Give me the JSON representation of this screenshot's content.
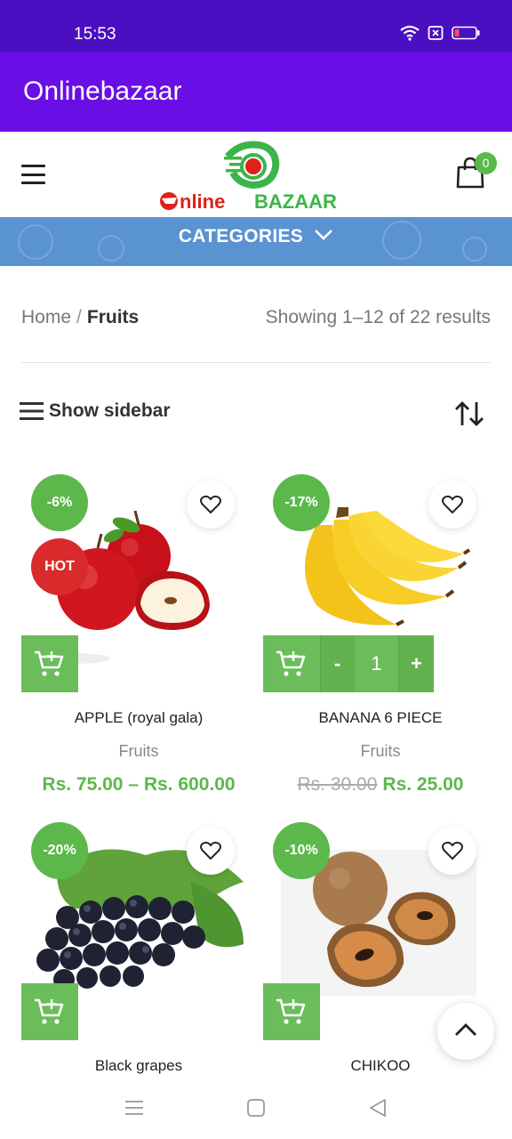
{
  "status_bar": {
    "time": "15:53",
    "icons": [
      "wifi-icon",
      "no-sim-icon",
      "battery-low-icon"
    ]
  },
  "app_bar": {
    "title": "Onlinebazaar"
  },
  "header": {
    "logo_text_prefix": "nline",
    "logo_text_suffix": "BAZAAR",
    "cart_count": "0"
  },
  "categories": {
    "label": "CATEGORIES"
  },
  "breadcrumb": {
    "home": "Home",
    "separator": "/",
    "current": "Fruits"
  },
  "results_text": "Showing 1–12 of 22 results",
  "toolbar": {
    "sidebar_label": "Show sidebar"
  },
  "colors": {
    "accent": "#5cb84b",
    "hot": "#d92b2b",
    "app_bar": "#6a0ee6",
    "status_bar": "#4a0fc0",
    "category_bar": "#5a93d2"
  },
  "products": [
    {
      "name": "APPLE (royal gala)",
      "category": "Fruits",
      "discount": "-6%",
      "hot": "HOT",
      "price": "Rs. 75.00 – Rs. 600.00",
      "old_price": ""
    },
    {
      "name": "BANANA 6 PIECE",
      "category": "Fruits",
      "discount": "-17%",
      "price": "Rs. 25.00",
      "old_price": "Rs. 30.00",
      "quantity": {
        "minus": "-",
        "value": "1",
        "plus": "+"
      }
    },
    {
      "name": "Black grapes",
      "category": "",
      "discount": "-20%",
      "price": "",
      "old_price": ""
    },
    {
      "name": "CHIKOO",
      "category": "",
      "discount": "-10%",
      "price": "",
      "old_price": ""
    }
  ]
}
